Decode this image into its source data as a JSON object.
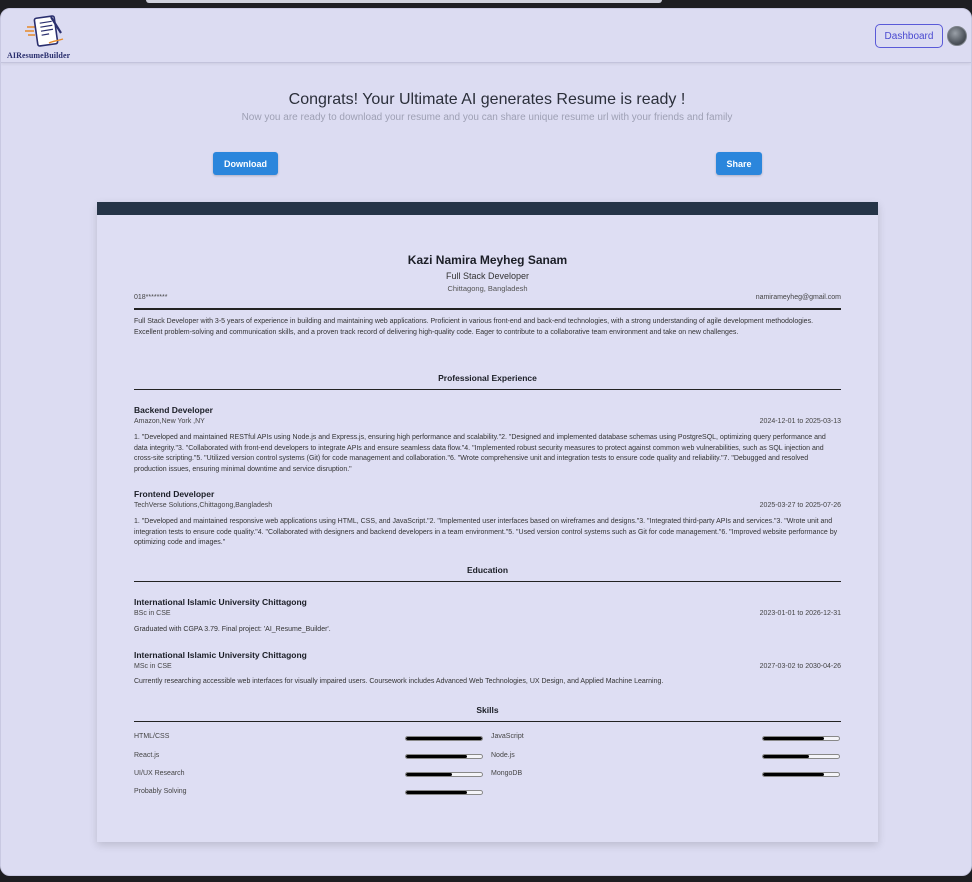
{
  "navbar": {
    "logo_text": "AIResumeBuilder",
    "dashboard_label": "Dashboard"
  },
  "hero": {
    "headline": "Congrats! Your Ultimate AI generates Resume is ready !",
    "subline": "Now you are ready to download your resume and you can share unique resume url with your friends and family",
    "download_label": "Download",
    "share_label": "Share"
  },
  "resume": {
    "name": "Kazi Namira Meyheg Sanam",
    "role": "Full Stack Developer",
    "location": "Chittagong, Bangladesh",
    "phone": "018********",
    "email": "namirameyheg@gmail.com",
    "summary": "Full Stack Developer with 3-5 years of experience in building and maintaining web applications. Proficient in various front-end and back-end technologies, with a strong understanding of agile development methodologies. Excellent problem-solving and communication skills, and a proven track record of delivering high-quality code. Eager to contribute to a collaborative team environment and take on new challenges.",
    "experience_title": "Professional Experience",
    "experience": [
      {
        "title": "Backend Developer",
        "company": "Amazon,New York ,NY",
        "dates": "2024-12-01 to 2025-03-13",
        "description": "1. \"Developed and maintained RESTful APIs using Node.js and Express.js, ensuring high performance and scalability.\"2.  \"Designed and implemented database schemas using PostgreSQL, optimizing query performance and data integrity.\"3.  \"Collaborated with front-end developers to integrate APIs and ensure seamless data flow.\"4. \"Implemented robust security measures to protect against common web vulnerabilities, such as SQL injection and cross-site scripting.\"5. \"Utilized version control systems (Git) for code management and collaboration.\"6. \"Wrote comprehensive unit and integration tests to ensure code quality and reliability.\"7. \"Debugged and resolved production issues, ensuring minimal downtime and service disruption.\""
      },
      {
        "title": "Frontend Developer",
        "company": "TechVerse Solutions,Chittagong,Bangladesh",
        "dates": "2025-03-27 to 2025-07-26",
        "description": "1. \"Developed and maintained responsive web applications using HTML, CSS, and JavaScript.\"2. \"Implemented user interfaces based on wireframes and designs.\"3. \"Integrated third-party APIs and services.\"3. \"Wrote unit and integration tests to ensure code quality.\"4. \"Collaborated with designers and backend developers in a team environment.\"5. \"Used version control systems such as Git for code management.\"6. \"Improved website performance by optimizing code and images.\""
      }
    ],
    "education_title": "Education",
    "education": [
      {
        "school": "International Islamic University Chittagong",
        "degree": "BSc in CSE",
        "dates": "2023-01-01 to 2026-12-31",
        "description": "Graduated with CGPA 3.79. Final project: 'AI_Resume_Builder'."
      },
      {
        "school": "International Islamic University Chittagong",
        "degree": "MSc in CSE",
        "dates": "2027-03-02 to 2030-04-26",
        "description": "Currently researching accessible web interfaces for visually impaired users. Coursework includes Advanced Web Technologies, UX Design, and Applied Machine Learning."
      }
    ],
    "skills_title": "Skills",
    "skills": [
      {
        "name": "HTML/CSS",
        "level": 1.0
      },
      {
        "name": "JavaScript",
        "level": 0.8
      },
      {
        "name": "React.js",
        "level": 0.8
      },
      {
        "name": "Node.js",
        "level": 0.6
      },
      {
        "name": "UI/UX Research",
        "level": 0.6
      },
      {
        "name": "MongoDB",
        "level": 0.8
      },
      {
        "name": "Probably Solving",
        "level": 0.8
      }
    ]
  }
}
